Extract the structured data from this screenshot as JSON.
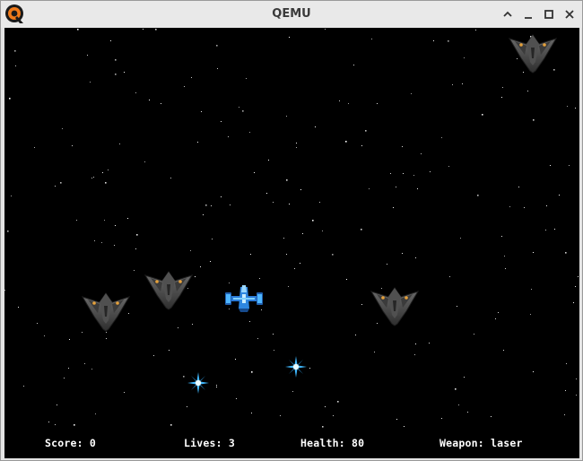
{
  "window": {
    "title": "QEMU"
  },
  "controls": [
    "chevron-up-icon",
    "minimize-icon",
    "maximize-icon",
    "close-icon"
  ],
  "hud": {
    "score": "Score: 0",
    "lives": "Lives: 3",
    "health": "Health: 80",
    "weapon": "Weapon: laser"
  },
  "game": {
    "player": {
      "icon": "player-spaceship-icon",
      "color": "#3aa0ff"
    },
    "enemies": [
      {
        "icon": "enemy-ship-icon"
      },
      {
        "icon": "enemy-ship-icon"
      },
      {
        "icon": "enemy-ship-icon"
      },
      {
        "icon": "enemy-ship-icon"
      }
    ],
    "projectiles": [
      {
        "icon": "energy-star-icon",
        "color": "#5ad8ff"
      },
      {
        "icon": "energy-star-icon",
        "color": "#5ad8ff"
      }
    ]
  }
}
